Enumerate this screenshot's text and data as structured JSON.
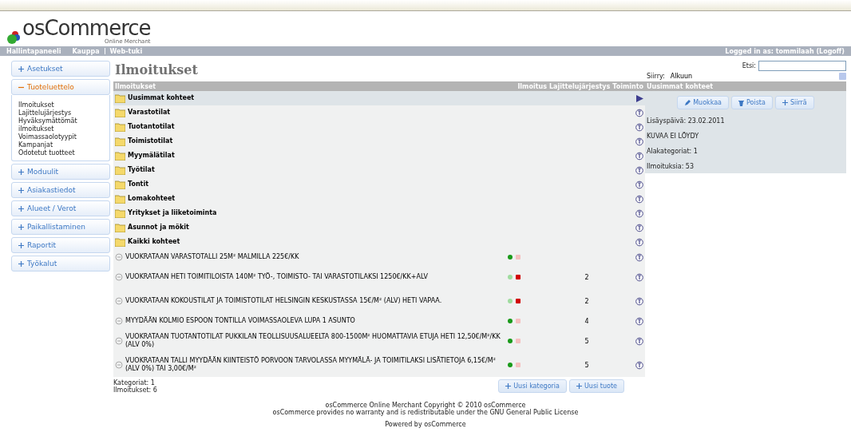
{
  "header": {
    "logo": "osCommerce",
    "tagline": "Online Merchant"
  },
  "nav": {
    "links": [
      "Hallintapaneeli",
      "Kauppa",
      "Web-tuki"
    ],
    "logged_in": "Logged in as: tommilaah (Logoff)"
  },
  "sidebar": [
    {
      "label": "Asetukset",
      "expanded": false
    },
    {
      "label": "Tuoteluettelo",
      "expanded": true,
      "children": [
        {
          "label": "Ilmoitukset"
        },
        {
          "label": "Lajittelujärjestys"
        },
        {
          "label": "Hyväksymättömät"
        },
        {
          "label": "ilmoitukset"
        },
        {
          "label": "Voimassaolotyypit"
        },
        {
          "label": "Kampanjat"
        },
        {
          "label": "Odotetut tuotteet"
        }
      ]
    },
    {
      "label": "Moduulit",
      "expanded": false
    },
    {
      "label": "Asiakastiedot",
      "expanded": false
    },
    {
      "label": "Alueet / Verot",
      "expanded": false
    },
    {
      "label": "Paikallistaminen",
      "expanded": false
    },
    {
      "label": "Raportit",
      "expanded": false
    },
    {
      "label": "Työkalut",
      "expanded": false
    }
  ],
  "page_title": "Ilmoitukset",
  "search": {
    "label": "Etsi:",
    "goto_label": "Siirry:",
    "goto_value": "Alkuun"
  },
  "table": {
    "columns": [
      "Ilmoitukset",
      "Ilmoitus",
      "Lajittelujärjestys",
      "Toiminto"
    ],
    "rows": [
      {
        "kind": "category",
        "name": "Uusimmat kohteet",
        "selected": true
      },
      {
        "kind": "category",
        "name": "Varastotilat",
        "selected": false
      },
      {
        "kind": "category",
        "name": "Tuotantotilat",
        "selected": false
      },
      {
        "kind": "category",
        "name": "Toimistotilat",
        "selected": false
      },
      {
        "kind": "category",
        "name": "Myymälätilat",
        "selected": false
      },
      {
        "kind": "category",
        "name": "Työtilat",
        "selected": false
      },
      {
        "kind": "category",
        "name": "Tontit",
        "selected": false
      },
      {
        "kind": "category",
        "name": "Lomakohteet",
        "selected": false
      },
      {
        "kind": "category",
        "name": "Yritykset ja liiketoiminta",
        "selected": false
      },
      {
        "kind": "category",
        "name": "Asunnot ja mökit",
        "selected": false
      },
      {
        "kind": "category",
        "name": "Kaikki kohteet",
        "selected": false
      },
      {
        "kind": "product",
        "name": "VUOKRATAAN VARASTOTALLI 25M² MALMILLA 225€/KK",
        "active": true,
        "sort": "",
        "selected": false
      },
      {
        "kind": "product",
        "name": "VUOKRATAAN HETI TOIMITILOISTA 140M² TYÖ-, TOIMISTO- TAI VARASTOTILAKSI 1250€/KK+ALV",
        "active": false,
        "sort": "2",
        "selected": false
      },
      {
        "kind": "product",
        "name": "VUOKRATAAN KOKOUSTILAT JA TOIMISTOTILAT HELSINGIN KESKUSTASSA 15€/M² (ALV) HETI VAPAA.",
        "active": false,
        "sort": "2",
        "selected": false
      },
      {
        "kind": "product",
        "name": "MYYDÄÄN KOLMIO ESPOON TONTILLA VOIMASSAOLEVA LUPA 1 ASUNTO",
        "active": true,
        "sort": "4",
        "selected": false
      },
      {
        "kind": "product",
        "name": "VUOKRATAAN TUOTANTOTILAT PUKKILAN TEOLLISUUSALUEELTA 800-1500M² HUOMATTAVIA ETUJA HETI 12,50€/M²/KK (ALV 0%)",
        "active": true,
        "sort": "5",
        "selected": false
      },
      {
        "kind": "product",
        "name": "VUOKRATAAN TALLI MYYDÄÄN KIINTEISTÖ PORVOON TARVOLASSA MYYMÄLÄ- JA TOIMITILAKSI LISÄTIETOJA 6,15€/M² (ALV 0%) TAI 3,00€/M²",
        "active": true,
        "sort": "5",
        "selected": false
      }
    ]
  },
  "summary": [
    "Kategoriat: 1",
    "Ilmoitukset: 6"
  ],
  "bottom_buttons": [
    "Uusi kategoria",
    "Uusi tuote"
  ],
  "info_panel": {
    "title": "Uusimmat kohteet",
    "buttons": [
      "Muokkaa",
      "Poista",
      "Siirrä"
    ],
    "lines": [
      "Lisäyspäivä: 23.02.2011",
      "KUVAA EI LÖYDY",
      "Alakategoriat: 1",
      "Ilmoituksia: 53"
    ]
  },
  "footer": [
    "osCommerce Online Merchant Copyright © 2010 osCommerce",
    "osCommerce provides no warranty and is redistributable under the GNU General Public License",
    "Powered by osCommerce"
  ]
}
